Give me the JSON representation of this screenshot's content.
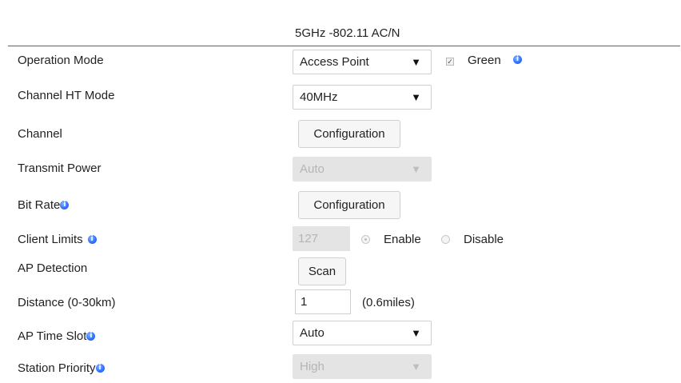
{
  "section_title": "5GHz -802.11 AC/N",
  "colors": {
    "rule": "#4a5ea8",
    "info_icon": "#2f74ff",
    "disabled_bg": "#e4e4e4"
  },
  "rows": {
    "operation_mode": {
      "label": "Operation Mode",
      "select_value": "Access Point",
      "green_label": "Green",
      "green_checked": true
    },
    "channel_ht_mode": {
      "label": "Channel HT Mode",
      "select_value": "40MHz"
    },
    "channel": {
      "label": "Channel",
      "button_label": "Configuration"
    },
    "transmit_power": {
      "label": "Transmit Power",
      "select_value": "Auto",
      "disabled": true
    },
    "bit_rate": {
      "label": "Bit Rate",
      "button_label": "Configuration"
    },
    "client_limits": {
      "label": "Client Limits",
      "input_value": "127",
      "enable_label": "Enable",
      "disable_label": "Disable",
      "selected": "Enable"
    },
    "ap_detection": {
      "label": "AP Detection",
      "button_label": "Scan"
    },
    "distance": {
      "label": "Distance (0-30km)",
      "input_value": "1",
      "unit_text": "(0.6miles)"
    },
    "ap_time_slot": {
      "label": "AP Time Slot",
      "select_value": "Auto"
    },
    "station_priority": {
      "label": "Station Priority",
      "select_value": "High",
      "disabled": true
    }
  },
  "icons": {
    "caret": "▼",
    "info": "i",
    "check": "✓"
  }
}
